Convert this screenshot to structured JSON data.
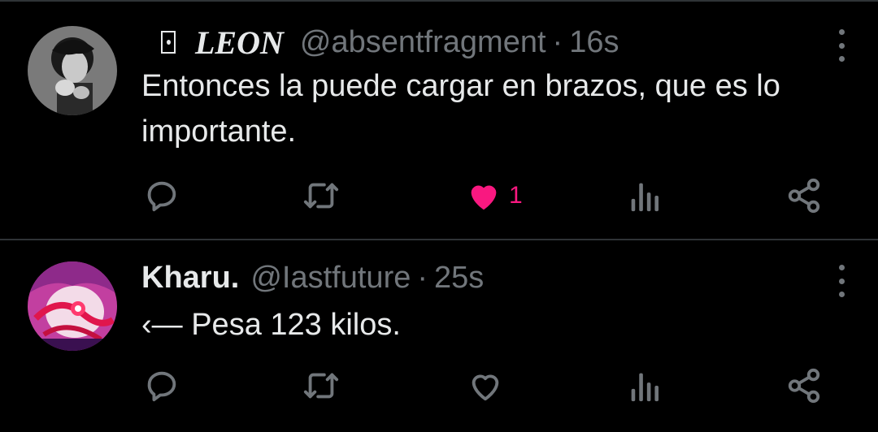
{
  "tweets": [
    {
      "name": "LEON",
      "handle": "@absentfragment",
      "separator": "·",
      "time": "16s",
      "text": "Entonces la puede cargar en brazos, que es lo importante.",
      "liked": true,
      "like_count": "1",
      "like_color": "#f91880"
    },
    {
      "name": "Kharu.",
      "handle": "@Iastfuture",
      "separator": "·",
      "time": "25s",
      "text": "‹— Pesa 123 kilos.",
      "liked": false,
      "like_count": "",
      "like_color": "#71767b"
    }
  ],
  "icons": {
    "reply": "reply-icon",
    "retweet": "retweet-icon",
    "like": "heart-icon",
    "views": "views-icon",
    "share": "share-icon",
    "more": "more-icon"
  },
  "colors": {
    "background": "#000000",
    "text": "#e7e9ea",
    "muted": "#71767b",
    "divider": "#2f3336",
    "like": "#f91880"
  }
}
